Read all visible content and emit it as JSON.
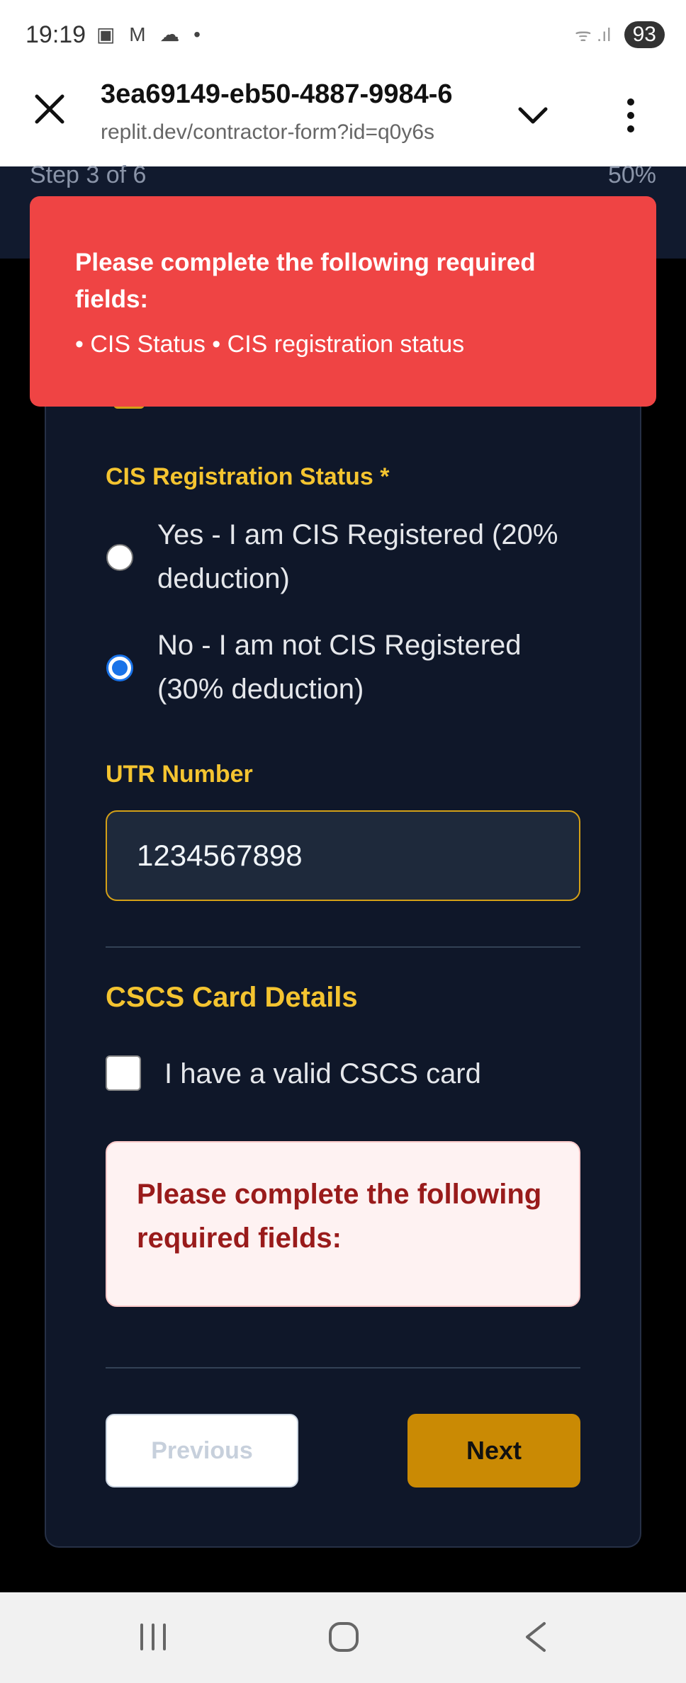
{
  "status_bar": {
    "time": "19:19",
    "notif_icons": "▣ M ☁ •",
    "battery": "93",
    "signal": "ᯤ .ıl"
  },
  "browser": {
    "title": "3ea69149-eb50-4887-9984-6",
    "url": "replit.dev/contractor-form?id=q0y6s"
  },
  "progress": {
    "step_text": "Step 3 of 6",
    "percent_text": "50%",
    "fraction": 0.5
  },
  "toast": {
    "title": "Please complete the following required fields:",
    "detail": "• CIS Status • CIS registration status"
  },
  "form": {
    "cis_label": "CIS Registration Status *",
    "cis_options": [
      {
        "label": "Yes - I am CIS Registered (20% deduction)",
        "selected": false
      },
      {
        "label": "No - I am not CIS Registered (30% deduction)",
        "selected": true
      }
    ],
    "utr_label": "UTR Number",
    "utr_value": "1234567898",
    "cscs_heading": "CSCS Card Details",
    "cscs_checkbox_label": "I have a valid CSCS card",
    "cscs_checked": false,
    "error_message": "Please complete the following required fields:"
  },
  "buttons": {
    "previous": "Previous",
    "next": "Next"
  },
  "colors": {
    "accent": "#f4c430",
    "next_button": "#ca8a04",
    "toast": "#ef4444",
    "card_bg": "#0f1729",
    "error_text": "#991b1b"
  },
  "icons": {
    "browser": [
      "close-icon",
      "chevron-down-icon",
      "more-vertical-icon"
    ],
    "nav": [
      "recent-apps-icon",
      "home-icon",
      "back-icon"
    ]
  }
}
